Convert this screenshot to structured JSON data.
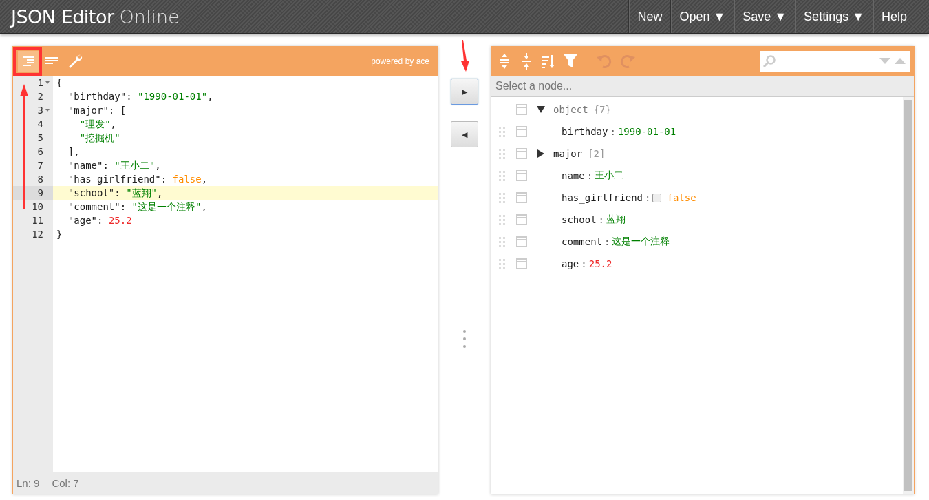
{
  "header": {
    "title": "JSON Editor",
    "subtitle": "Online",
    "menu": [
      {
        "label": "New"
      },
      {
        "label": "Open ▼"
      },
      {
        "label": "Save ▼"
      },
      {
        "label": "Settings ▼"
      },
      {
        "label": "Help"
      }
    ]
  },
  "code_editor": {
    "powered_by": "powered by ace",
    "tools": [
      {
        "selected": true
      },
      {
        "selected": false
      },
      {
        "selected": false
      }
    ],
    "lines": [
      {
        "number": "1",
        "fold": true,
        "active": false,
        "tokens": [
          {
            "text": "{",
            "kind": "punct"
          }
        ]
      },
      {
        "number": "2",
        "fold": false,
        "active": false,
        "tokens": [
          {
            "text": "  \"birthday\"",
            "kind": "key"
          },
          {
            "text": ": ",
            "kind": "punct"
          },
          {
            "text": "\"1990-01-01\"",
            "kind": "string"
          },
          {
            "text": ",",
            "kind": "punct"
          }
        ]
      },
      {
        "number": "3",
        "fold": true,
        "active": false,
        "tokens": [
          {
            "text": "  \"major\"",
            "kind": "key"
          },
          {
            "text": ": [",
            "kind": "punct"
          }
        ]
      },
      {
        "number": "4",
        "fold": false,
        "active": false,
        "tokens": [
          {
            "text": "    \"理发\"",
            "kind": "string"
          },
          {
            "text": ",",
            "kind": "punct"
          }
        ]
      },
      {
        "number": "5",
        "fold": false,
        "active": false,
        "tokens": [
          {
            "text": "    \"挖掘机\"",
            "kind": "string"
          }
        ]
      },
      {
        "number": "6",
        "fold": false,
        "active": false,
        "tokens": [
          {
            "text": "  ],",
            "kind": "punct"
          }
        ]
      },
      {
        "number": "7",
        "fold": false,
        "active": false,
        "tokens": [
          {
            "text": "  \"name\"",
            "kind": "key"
          },
          {
            "text": ": ",
            "kind": "punct"
          },
          {
            "text": "\"王小二\"",
            "kind": "string"
          },
          {
            "text": ",",
            "kind": "punct"
          }
        ]
      },
      {
        "number": "8",
        "fold": false,
        "active": false,
        "tokens": [
          {
            "text": "  \"has_girlfriend\"",
            "kind": "key"
          },
          {
            "text": ": ",
            "kind": "punct"
          },
          {
            "text": "false",
            "kind": "bool"
          },
          {
            "text": ",",
            "kind": "punct"
          }
        ]
      },
      {
        "number": "9",
        "fold": false,
        "active": true,
        "tokens": [
          {
            "text": "  \"school\"",
            "kind": "key"
          },
          {
            "text": ": ",
            "kind": "punct"
          },
          {
            "text": "\"蓝翔\"",
            "kind": "string"
          },
          {
            "text": ",",
            "kind": "punct"
          }
        ]
      },
      {
        "number": "10",
        "fold": false,
        "active": false,
        "tokens": [
          {
            "text": "  \"comment\"",
            "kind": "key"
          },
          {
            "text": ": ",
            "kind": "punct"
          },
          {
            "text": "\"这是一个注释\"",
            "kind": "string"
          },
          {
            "text": ",",
            "kind": "punct"
          }
        ]
      },
      {
        "number": "11",
        "fold": false,
        "active": false,
        "tokens": [
          {
            "text": "  \"age\"",
            "kind": "key"
          },
          {
            "text": ": ",
            "kind": "punct"
          },
          {
            "text": "25.2",
            "kind": "number"
          }
        ]
      },
      {
        "number": "12",
        "fold": false,
        "active": false,
        "tokens": [
          {
            "text": "}",
            "kind": "punct"
          }
        ]
      }
    ],
    "status": {
      "line": "Ln: 9",
      "column": "Col: 7"
    }
  },
  "copy_buttons": [
    {
      "label": "▶",
      "focused": true
    },
    {
      "label": "◀",
      "focused": false
    }
  ],
  "tree_editor": {
    "placeholder": "Select a node...",
    "root": {
      "key": "object",
      "count": "{7}",
      "expanded": true,
      "children": [
        {
          "key": "birthday",
          "kind": "string",
          "separator": ":",
          "value": "1990-01-01"
        },
        {
          "key": "major",
          "kind": "array",
          "count": "[2]",
          "expanded": false
        },
        {
          "key": "name",
          "kind": "string",
          "separator": ":",
          "value": "王小二"
        },
        {
          "key": "has_girlfriend",
          "kind": "bool",
          "separator": ":",
          "checked": false,
          "value": "false"
        },
        {
          "key": "school",
          "kind": "string",
          "separator": ":",
          "value": "蓝翔"
        },
        {
          "key": "comment",
          "kind": "string",
          "separator": ":",
          "value": "这是一个注释"
        },
        {
          "key": "age",
          "kind": "number",
          "separator": ":",
          "value": "25.2"
        }
      ]
    }
  }
}
